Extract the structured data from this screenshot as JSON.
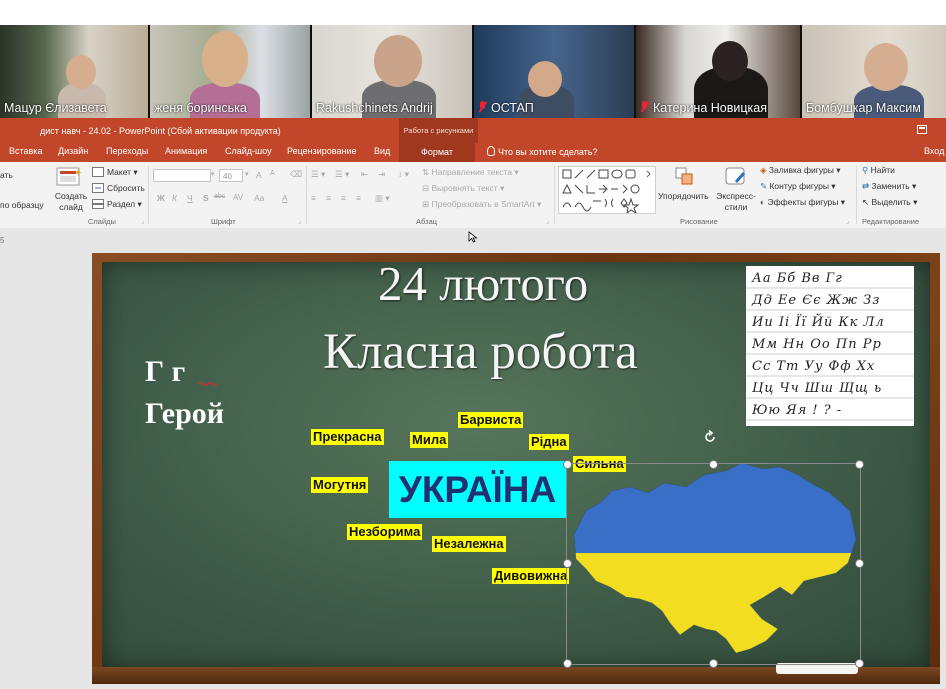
{
  "video_call": {
    "participants": [
      {
        "name": "Мацур Єлизавета",
        "muted": false
      },
      {
        "name": "женя боринська",
        "muted": false
      },
      {
        "name": "Rakushchinets Andrij",
        "muted": false
      },
      {
        "name": "ОСТАП",
        "muted": true
      },
      {
        "name": "Катерина Новицкая",
        "muted": true
      },
      {
        "name": "Бомбушкар Максим",
        "muted": false
      }
    ]
  },
  "window": {
    "title": "дист навч - 24.02 - PowerPoint (Сбой активации продукта)",
    "context_tab_group": "Работа с рисунками",
    "login_label": "Вход"
  },
  "ribbon_tabs": [
    "Вставка",
    "Дизайн",
    "Переходы",
    "Анимация",
    "Слайд-шоу",
    "Рецензирование",
    "Вид",
    "Формат"
  ],
  "active_tab": "Формат",
  "tell_me": "Что вы хотите сделать?",
  "ribbon": {
    "slides": {
      "partial_top": "ать",
      "partial_bottom": "по образцу",
      "create_slide": "Создать слайд",
      "layout": "Макет",
      "reset": "Сбросить",
      "section": "Раздел",
      "group_label": "Слайды"
    },
    "font": {
      "size": "40",
      "bold": "Ж",
      "italic": "К",
      "underline": "Ч",
      "strike": "S",
      "spacing": "abc",
      "spacing2": "AV",
      "case": "Aa",
      "color": "A",
      "grow": "A",
      "shrink": "A",
      "group_label": "Шрифт"
    },
    "paragraph": {
      "text_direction": "Направление текста",
      "align_text": "Выровнять текст",
      "smartart": "Преобразовать в SmartArt",
      "group_label": "Абзац"
    },
    "drawing": {
      "arrange": "Упорядочить",
      "quick_styles": "Экспресс-стили",
      "shape_fill": "Заливка фигуры",
      "shape_outline": "Контур фигуры",
      "shape_effects": "Эффекты фигуры",
      "group_label": "Рисование"
    },
    "editing": {
      "find": "Найти",
      "replace": "Заменить",
      "select": "Выделить",
      "group_label": "Редактирование"
    }
  },
  "slide_number_partial": "5",
  "slide": {
    "date": "24 лютого",
    "work_type": "Класна робота",
    "letters": "Г    г",
    "hero_word": "Герой",
    "center_word": "УКРАЇНА",
    "adjectives": [
      {
        "text": "Прекрасна"
      },
      {
        "text": "Мила"
      },
      {
        "text": "Барвиста"
      },
      {
        "text": "Рідна"
      },
      {
        "text": "Сильна"
      },
      {
        "text": "Могутня"
      },
      {
        "text": "Незборима"
      },
      {
        "text": "Незалежна"
      },
      {
        "text": "Дивовижна"
      }
    ],
    "cursive_rows": [
      "Аа Бб Вв Гг",
      "Дд Ее Єє Жж Зз",
      "Ии Іі Її Йй Кк Лл",
      "Мм Нн Оо Пп Рр",
      "Сс Тт Уу Фф Хх",
      "Цц Чч Шш Щщ ь",
      "Юю Яя ! ? -"
    ],
    "flag_colors": {
      "blue": "#3a6fc7",
      "yellow": "#f2dd20"
    }
  }
}
